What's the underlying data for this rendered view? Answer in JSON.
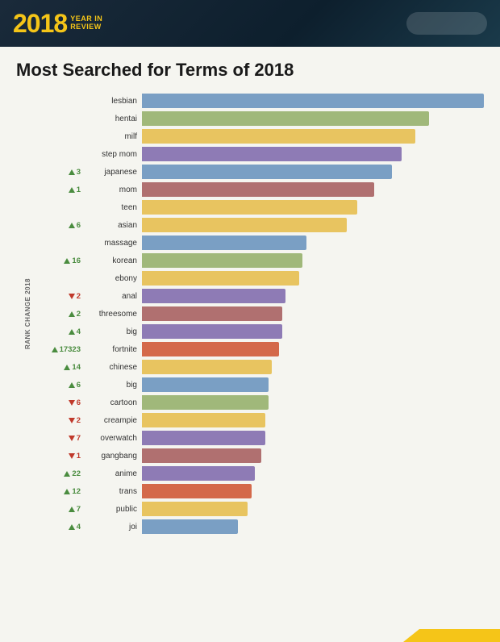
{
  "header": {
    "year": "2018",
    "subtitle_line1": "YEAR IN",
    "subtitle_line2": "REVIEW"
  },
  "chart": {
    "title": "Most Searched for Terms of 2018",
    "rank_label": "RANK CHANGE 2018",
    "bars": [
      {
        "label": "lesbian",
        "change": "",
        "direction": "none",
        "pct": 100,
        "color": "#7a9fc4"
      },
      {
        "label": "hentai",
        "change": "",
        "direction": "none",
        "pct": 84,
        "color": "#a0b87a"
      },
      {
        "label": "milf",
        "change": "",
        "direction": "none",
        "pct": 80,
        "color": "#e8c460"
      },
      {
        "label": "step mom",
        "change": "",
        "direction": "none",
        "pct": 76,
        "color": "#8e7bb5"
      },
      {
        "label": "japanese",
        "change": "3",
        "direction": "up",
        "pct": 73,
        "color": "#7a9fc4"
      },
      {
        "label": "mom",
        "change": "1",
        "direction": "up",
        "pct": 68,
        "color": "#b07070"
      },
      {
        "label": "teen",
        "change": "",
        "direction": "none",
        "pct": 63,
        "color": "#e8c460"
      },
      {
        "label": "asian",
        "change": "6",
        "direction": "up",
        "pct": 60,
        "color": "#e8c460"
      },
      {
        "label": "massage",
        "change": "",
        "direction": "none",
        "pct": 48,
        "color": "#7a9fc4"
      },
      {
        "label": "korean",
        "change": "16",
        "direction": "up",
        "pct": 47,
        "color": "#a0b87a"
      },
      {
        "label": "ebony",
        "change": "",
        "direction": "none",
        "pct": 46,
        "color": "#e8c460"
      },
      {
        "label": "anal",
        "change": "2",
        "direction": "down",
        "pct": 42,
        "color": "#8e7bb5"
      },
      {
        "label": "threesome",
        "change": "2",
        "direction": "up",
        "pct": 41,
        "color": "#b07070"
      },
      {
        "label": "big",
        "change": "4",
        "direction": "up",
        "pct": 41,
        "color": "#8e7bb5"
      },
      {
        "label": "fortnite",
        "change": "17323",
        "direction": "up",
        "pct": 40,
        "color": "#d4694a"
      },
      {
        "label": "chinese",
        "change": "14",
        "direction": "up",
        "pct": 38,
        "color": "#e8c460"
      },
      {
        "label": "big",
        "change": "6",
        "direction": "up",
        "pct": 37,
        "color": "#7a9fc4"
      },
      {
        "label": "cartoon",
        "change": "6",
        "direction": "down",
        "pct": 37,
        "color": "#a0b87a"
      },
      {
        "label": "creampie",
        "change": "2",
        "direction": "down",
        "pct": 36,
        "color": "#e8c460"
      },
      {
        "label": "overwatch",
        "change": "7",
        "direction": "down",
        "pct": 36,
        "color": "#8e7bb5"
      },
      {
        "label": "gangbang",
        "change": "1",
        "direction": "down",
        "pct": 35,
        "color": "#b07070"
      },
      {
        "label": "anime",
        "change": "22",
        "direction": "up",
        "pct": 33,
        "color": "#8e7bb5"
      },
      {
        "label": "trans",
        "change": "12",
        "direction": "up",
        "pct": 32,
        "color": "#d4694a"
      },
      {
        "label": "public",
        "change": "7",
        "direction": "up",
        "pct": 31,
        "color": "#e8c460"
      },
      {
        "label": "joi",
        "change": "4",
        "direction": "up",
        "pct": 28,
        "color": "#7a9fc4"
      }
    ]
  }
}
